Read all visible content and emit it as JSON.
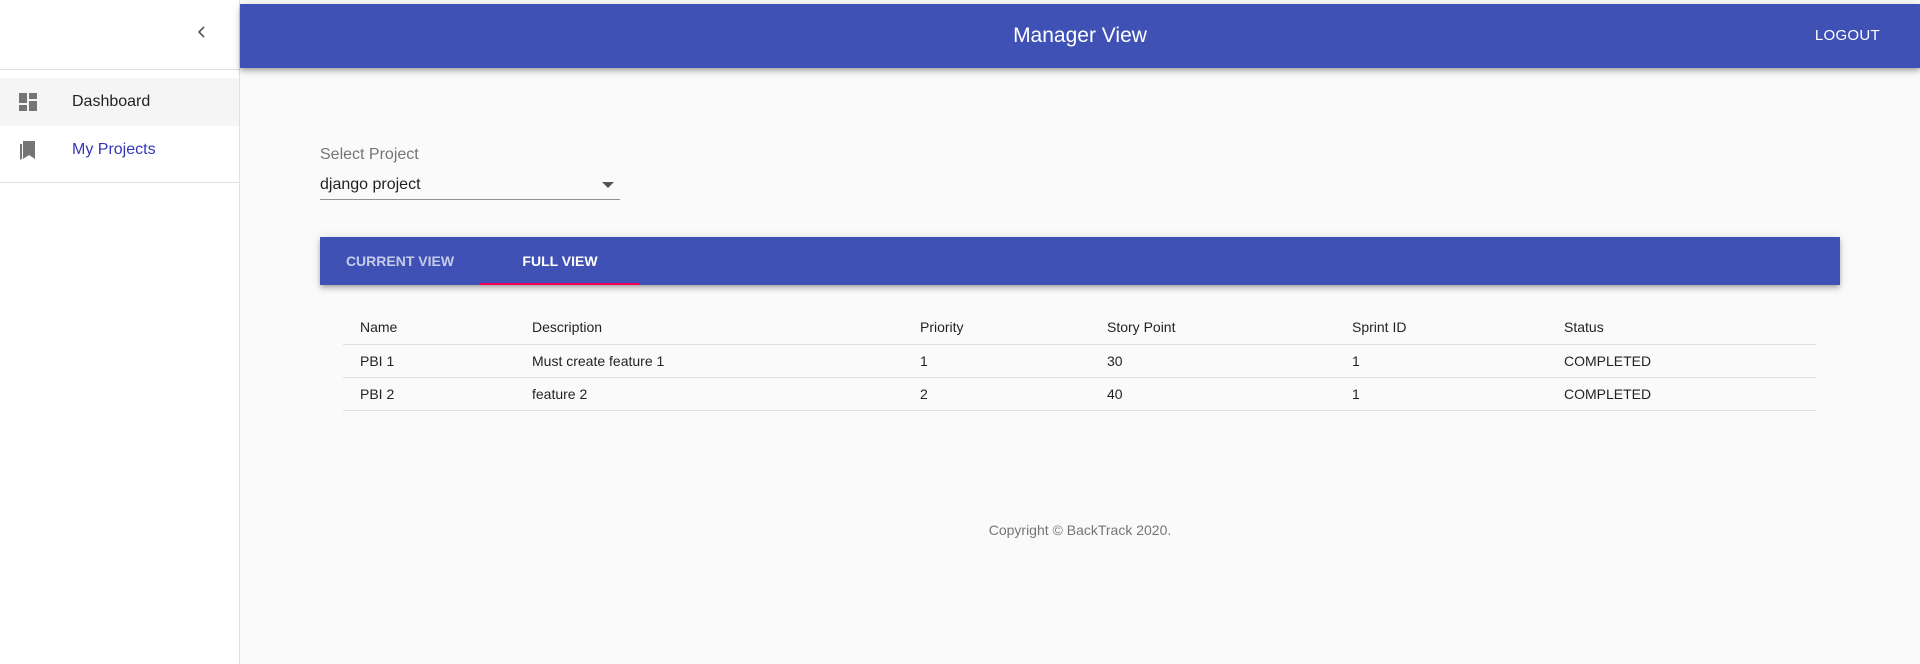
{
  "sidebar": {
    "collapse_icon": "chevron-left-icon",
    "items": [
      {
        "label": "Dashboard",
        "icon": "dashboard-icon",
        "active": false
      },
      {
        "label": "My Projects",
        "icon": "bookmarks-icon",
        "active": true
      }
    ]
  },
  "appbar": {
    "title": "Manager View",
    "logout_label": "LOGOUT",
    "color": "#3f51b5"
  },
  "project_select": {
    "label": "Select Project",
    "value": "django project"
  },
  "tabs": {
    "items": [
      {
        "label": "CURRENT VIEW",
        "selected": false
      },
      {
        "label": "FULL VIEW",
        "selected": true
      }
    ],
    "indicator_color": "#f50057"
  },
  "table": {
    "columns": [
      "Name",
      "Description",
      "Priority",
      "Story Point",
      "Sprint ID",
      "Status"
    ],
    "rows": [
      [
        "PBI 1",
        "Must create feature 1",
        "1",
        "30",
        "1",
        "COMPLETED"
      ],
      [
        "PBI 2",
        "feature 2",
        "2",
        "40",
        "1",
        "COMPLETED"
      ]
    ]
  },
  "footer": {
    "copyright": "Copyright © BackTrack 2020."
  }
}
